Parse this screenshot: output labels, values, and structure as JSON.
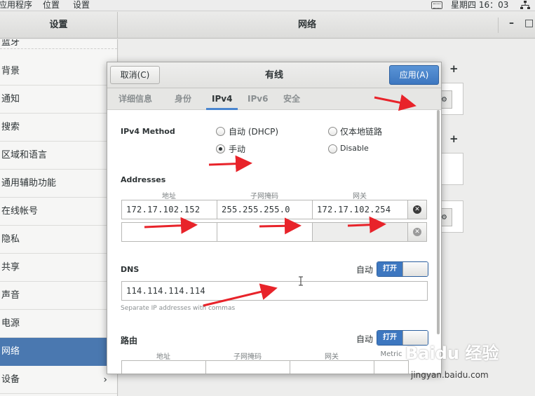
{
  "topbar": {
    "menus": [
      "应用程序",
      "位置",
      "设置"
    ],
    "clock": "星期四 16：03"
  },
  "header": {
    "sidebar_title": "设置",
    "main_title": "网络",
    "minimize": "–",
    "maximize": "□"
  },
  "sidebar": {
    "items": [
      {
        "label": "蓝牙"
      },
      {
        "label": "背景"
      },
      {
        "label": "通知"
      },
      {
        "label": "搜索"
      },
      {
        "label": "区域和语言"
      },
      {
        "label": "通用辅助功能"
      },
      {
        "label": "在线帐号"
      },
      {
        "label": "隐私"
      },
      {
        "label": "共享"
      },
      {
        "label": "声音"
      },
      {
        "label": "电源"
      },
      {
        "label": "网络",
        "active": true
      },
      {
        "label": "设备",
        "chevron": "›"
      }
    ]
  },
  "main": {
    "plus_label": "+"
  },
  "dialog": {
    "cancel_label": "取消(C)",
    "title": "有线",
    "apply_label": "应用(A)",
    "tabs": [
      "详细信息",
      "身份",
      "IPv4",
      "IPv6",
      "安全"
    ],
    "active_tab": "IPv4",
    "ipv4_method_label": "IPv4 Method",
    "methods": {
      "auto": "自动 (DHCP)",
      "link_local": "仅本地链路",
      "manual": "手动",
      "disable": "Disable",
      "selected": "manual"
    },
    "addresses_label": "Addresses",
    "address_columns": [
      "地址",
      "子网掩码",
      "网关"
    ],
    "address_rows": [
      {
        "address": "172.17.102.152",
        "netmask": "255.255.255.0",
        "gateway": "172.17.102.254"
      },
      {
        "address": "",
        "netmask": "",
        "gateway": ""
      }
    ],
    "dns_label": "DNS",
    "dns_auto_label": "自动",
    "dns_switch_label": "打开",
    "dns_value": "114.114.114.114",
    "dns_hint": "Separate IP addresses with commas",
    "routes_label": "路由",
    "routes_auto_label": "自动",
    "routes_switch_label": "打开",
    "route_columns": [
      "地址",
      "子网掩码",
      "网关",
      "Metric"
    ]
  },
  "watermark": {
    "logo": "Baidu 经验",
    "url": "jingyan.baidu.com"
  },
  "colors": {
    "accent": "#3d77c0",
    "sidebar_active": "#4a78b0",
    "arrow": "#e8232a"
  },
  "icons": [
    "keyboard-icon",
    "network-icon",
    "close-icon",
    "text-cursor-icon",
    "chevron-right-icon"
  ]
}
